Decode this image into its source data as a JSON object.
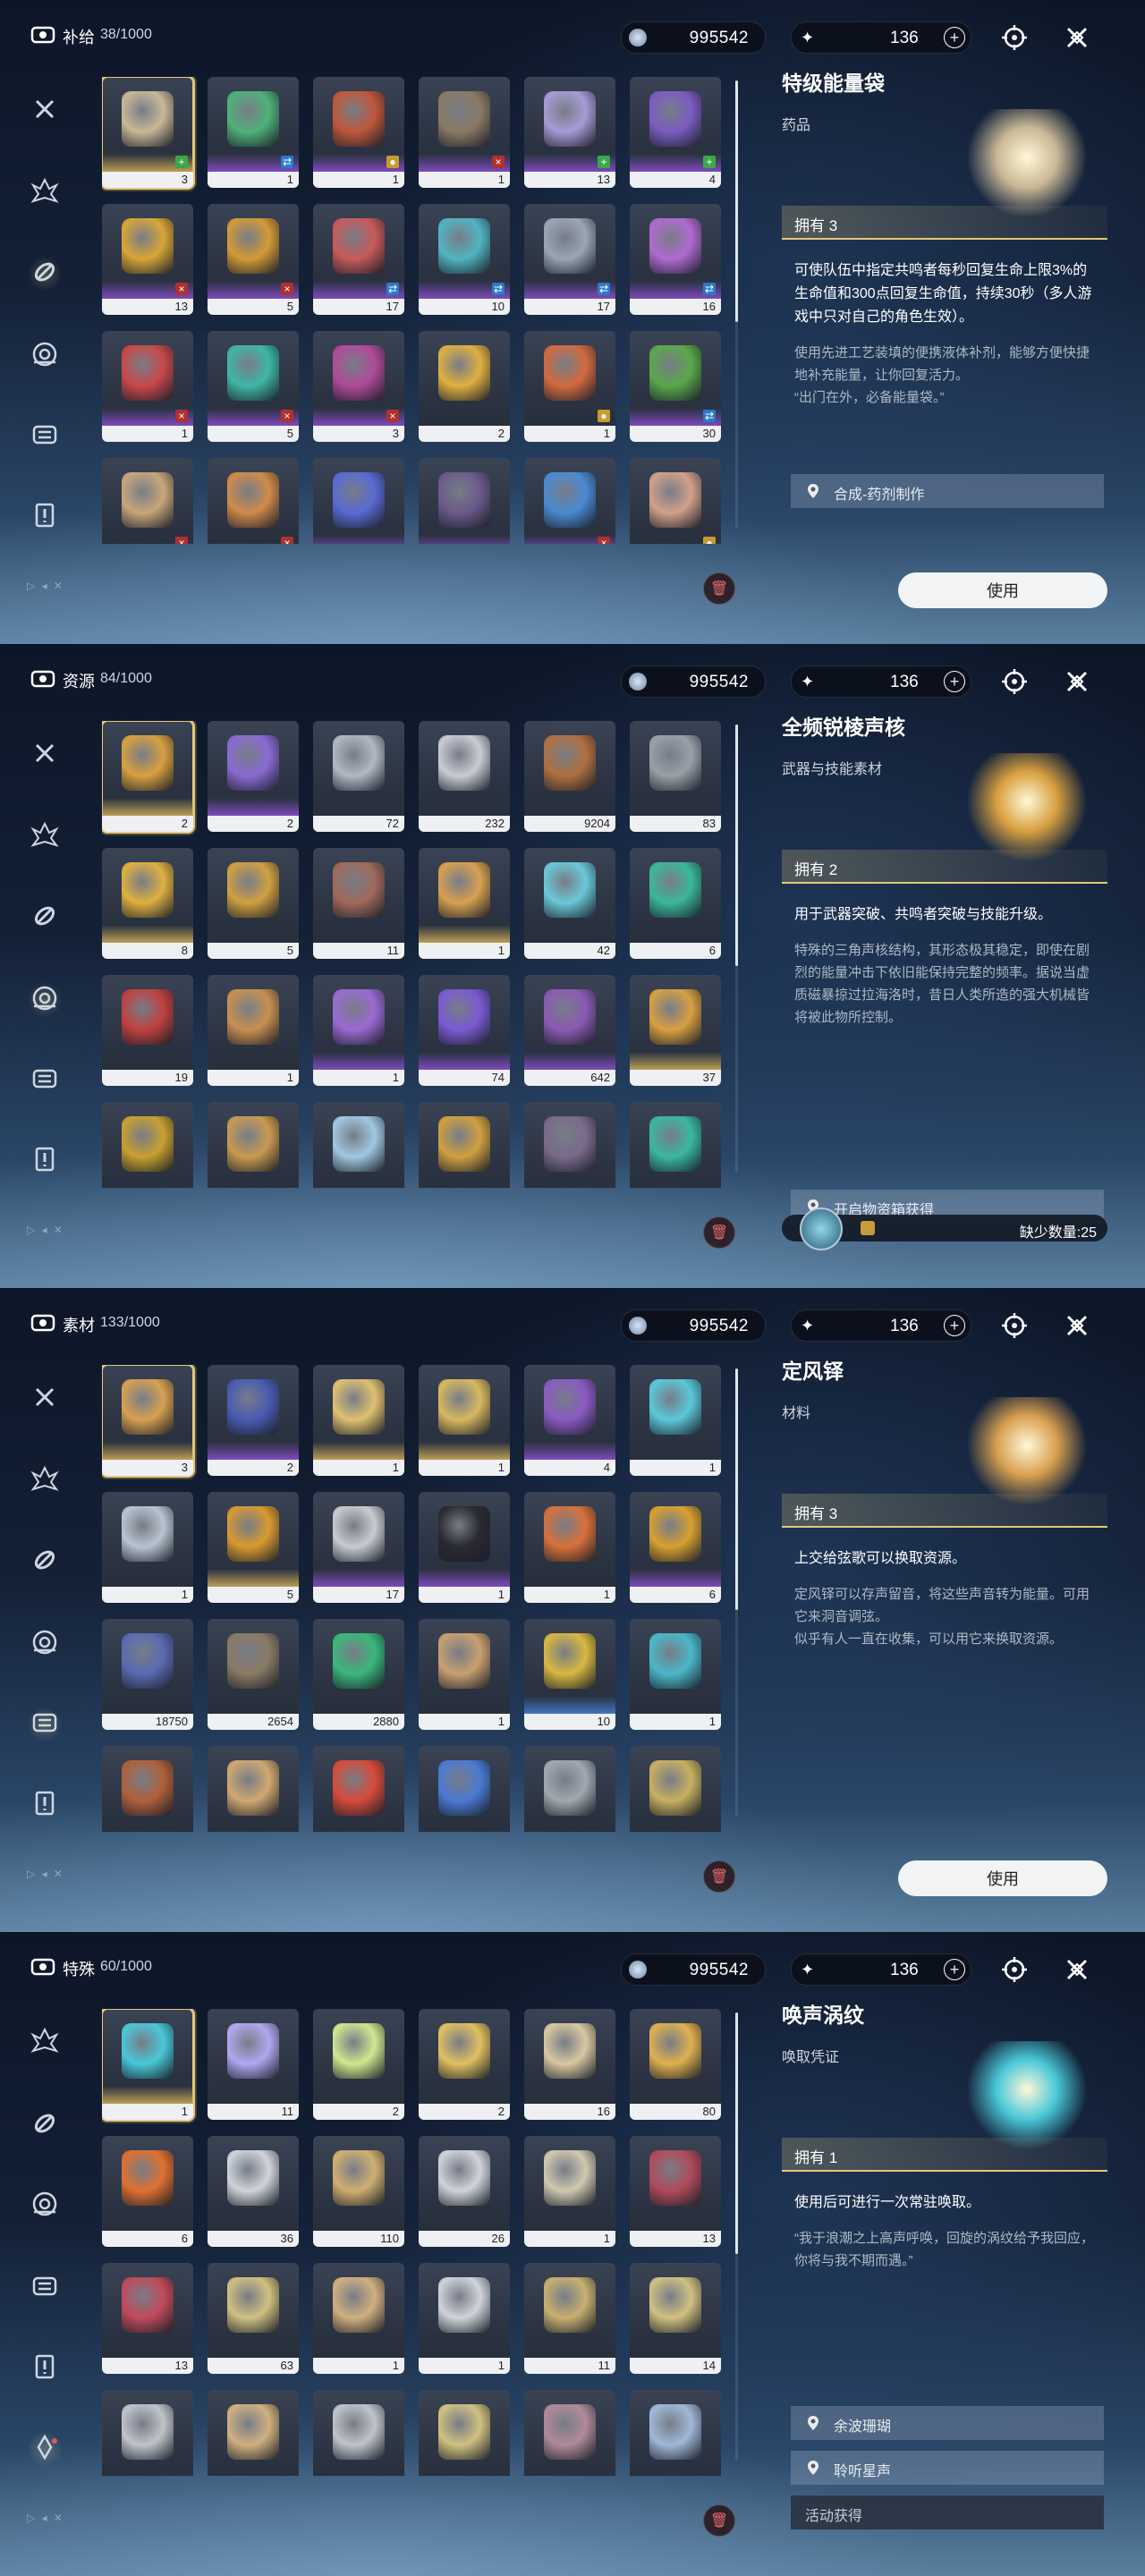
{
  "panels": [
    {
      "category": "补给",
      "count": "38/1000",
      "currency": "995542",
      "stamina": "136",
      "detail": {
        "name": "特级能量袋",
        "type": "药品",
        "owned": "拥有 3",
        "effect": "可使队伍中指定共鸣者每秒回复生命上限3%的生命值和300点回复生命值，持续30秒（多人游戏中只对自己的角色生效）。",
        "description": "使用先进工艺装填的便携液体补剂，能够方便快捷地补充能量，让你回复活力。\n“出门在外，必备能量袋。”",
        "sources": [
          "合成-药剂制作"
        ],
        "use_label": "使用"
      },
      "items": [
        {
          "count": "3",
          "color": "#c9b896",
          "bar": "gold",
          "tag": "plus"
        },
        {
          "count": "1",
          "color": "#4fb27a",
          "bar": "purple",
          "tag": "swap"
        },
        {
          "count": "1",
          "color": "#c0573a",
          "bar": "purple",
          "tag": "gold"
        },
        {
          "count": "1",
          "color": "#8a7a64",
          "bar": "purple",
          "tag": "x"
        },
        {
          "count": "13",
          "color": "#a89bd6",
          "bar": "purple",
          "tag": "plus"
        },
        {
          "count": "4",
          "color": "#7b5cc2",
          "bar": "purple",
          "tag": "plus"
        },
        {
          "count": "13",
          "color": "#d9a636",
          "bar": "purple",
          "tag": "x"
        },
        {
          "count": "5",
          "color": "#d49a36",
          "bar": "purple",
          "tag": "x"
        },
        {
          "count": "17",
          "color": "#c85a5a",
          "bar": "purple",
          "tag": "swap"
        },
        {
          "count": "10",
          "color": "#52b4c2",
          "bar": "purple",
          "tag": "swap"
        },
        {
          "count": "17",
          "color": "#9aa6b4",
          "bar": "purple",
          "tag": "swap"
        },
        {
          "count": "16",
          "color": "#b06ad0",
          "bar": "purple",
          "tag": "swap"
        },
        {
          "count": "1",
          "color": "#c84848",
          "bar": "purple",
          "tag": "x"
        },
        {
          "count": "5",
          "color": "#3fb6a6",
          "bar": "purple",
          "tag": "x"
        },
        {
          "count": "3",
          "color": "#b04a9a",
          "bar": "purple",
          "tag": "x"
        },
        {
          "count": "2",
          "color": "#e0b040",
          "bar": "none",
          "tag": "none"
        },
        {
          "count": "1",
          "color": "#d26a40",
          "bar": "none",
          "tag": "gold"
        },
        {
          "count": "30",
          "color": "#5aa84a",
          "bar": "purple",
          "tag": "swap"
        },
        {
          "count": "",
          "color": "#c8a67a",
          "bar": "none",
          "tag": "x"
        },
        {
          "count": "",
          "color": "#d08a4a",
          "bar": "none",
          "tag": "x"
        },
        {
          "count": "",
          "color": "#5a6ad2",
          "bar": "purple",
          "tag": "none"
        },
        {
          "count": "",
          "color": "#6a5a8a",
          "bar": "purple",
          "tag": "none"
        },
        {
          "count": "",
          "color": "#4a8ad2",
          "bar": "purple",
          "tag": "x"
        },
        {
          "count": "",
          "color": "#d2a08a",
          "bar": "none",
          "tag": "gold"
        }
      ]
    },
    {
      "category": "资源",
      "count": "84/1000",
      "currency": "995542",
      "stamina": "136",
      "detail": {
        "name": "全频锐棱声核",
        "type": "武器与技能素材",
        "owned": "拥有 2",
        "effect": "用于武器突破、共鸣者突破与技能升级。",
        "description": "特殊的三角声核结构，其形态极其稳定，即使在剧烈的能量冲击下依旧能保持完整的频率。据说当虚质磁暴掠过拉海洛时，昔日人类所造的强大机械皆将被此物所控制。",
        "sources": [
          "开启物资箱获得"
        ],
        "missing": "缺少数量:25"
      },
      "items": [
        {
          "count": "2",
          "color": "#d8a040",
          "bar": "gold",
          "tag": "none"
        },
        {
          "count": "2",
          "color": "#8a6ad2",
          "bar": "purple",
          "tag": "none"
        },
        {
          "count": "72",
          "color": "#b0b8c4",
          "bar": "none",
          "tag": "none"
        },
        {
          "count": "232",
          "color": "#c8ccd4",
          "bar": "none",
          "tag": "none"
        },
        {
          "count": "9204",
          "color": "#b07040",
          "bar": "none",
          "tag": "none"
        },
        {
          "count": "83",
          "color": "#9aa0a8",
          "bar": "none",
          "tag": "none"
        },
        {
          "count": "8",
          "color": "#e0b040",
          "bar": "gold",
          "tag": "none"
        },
        {
          "count": "5",
          "color": "#d0a040",
          "bar": "none",
          "tag": "none"
        },
        {
          "count": "11",
          "color": "#a06a5a",
          "bar": "none",
          "tag": "none"
        },
        {
          "count": "1",
          "color": "#d8a050",
          "bar": "gold",
          "tag": "none"
        },
        {
          "count": "42",
          "color": "#6ac8d8",
          "bar": "none",
          "tag": "none"
        },
        {
          "count": "6",
          "color": "#3ab89a",
          "bar": "none",
          "tag": "none"
        },
        {
          "count": "19",
          "color": "#c04040",
          "bar": "none",
          "tag": "none"
        },
        {
          "count": "1",
          "color": "#c89050",
          "bar": "none",
          "tag": "none"
        },
        {
          "count": "1",
          "color": "#9a6ad2",
          "bar": "purple",
          "tag": "none"
        },
        {
          "count": "74",
          "color": "#7a5ad2",
          "bar": "purple",
          "tag": "none"
        },
        {
          "count": "642",
          "color": "#8a5ab2",
          "bar": "purple",
          "tag": "none"
        },
        {
          "count": "37",
          "color": "#d8a040",
          "bar": "gold",
          "tag": "none"
        },
        {
          "count": "",
          "color": "#c8a030",
          "bar": "none",
          "tag": "none"
        },
        {
          "count": "",
          "color": "#c89a50",
          "bar": "none",
          "tag": "none"
        },
        {
          "count": "",
          "color": "#a0c8e0",
          "bar": "none",
          "tag": "none"
        },
        {
          "count": "",
          "color": "#d0a040",
          "bar": "none",
          "tag": "none"
        },
        {
          "count": "",
          "color": "#7a6a8a",
          "bar": "none",
          "tag": "none"
        },
        {
          "count": "",
          "color": "#3ab8a0",
          "bar": "none",
          "tag": "none"
        }
      ]
    },
    {
      "category": "素材",
      "count": "133/1000",
      "currency": "995542",
      "stamina": "136",
      "detail": {
        "name": "定风铎",
        "type": "材料",
        "owned": "拥有 3",
        "effect": "上交给弦歌可以换取资源。",
        "description": "定风铎可以存声留音，将这些声音转为能量。可用它来洞音调弦。\n似乎有人一直在收集，可以用它来换取资源。",
        "use_label": "使用"
      },
      "items": [
        {
          "count": "3",
          "color": "#d8a050",
          "bar": "gold",
          "tag": "none"
        },
        {
          "count": "2",
          "color": "#4a5ab2",
          "bar": "purple",
          "tag": "none"
        },
        {
          "count": "1",
          "color": "#e0c070",
          "bar": "gold",
          "tag": "none"
        },
        {
          "count": "1",
          "color": "#d8b860",
          "bar": "gold",
          "tag": "none"
        },
        {
          "count": "4",
          "color": "#8a5ac2",
          "bar": "purple",
          "tag": "none"
        },
        {
          "count": "1",
          "color": "#5ac8d8",
          "bar": "none",
          "tag": "none"
        },
        {
          "count": "1",
          "color": "#b8c4d0",
          "bar": "none",
          "tag": "none"
        },
        {
          "count": "5",
          "color": "#d89a30",
          "bar": "gold",
          "tag": "none"
        },
        {
          "count": "17",
          "color": "#c8ccd0",
          "bar": "purple",
          "tag": "none"
        },
        {
          "count": "1",
          "color": "#2a2a30",
          "bar": "purple",
          "tag": "none"
        },
        {
          "count": "1",
          "color": "#d8703a",
          "bar": "none",
          "tag": "none"
        },
        {
          "count": "6",
          "color": "#d8a030",
          "bar": "purple",
          "tag": "none"
        },
        {
          "count": "18750",
          "color": "#5a6ab2",
          "bar": "none",
          "tag": "none"
        },
        {
          "count": "2654",
          "color": "#8a7a64",
          "bar": "none",
          "tag": "none"
        },
        {
          "count": "2880",
          "color": "#3ab87a",
          "bar": "none",
          "tag": "none"
        },
        {
          "count": "1",
          "color": "#c8a070",
          "bar": "none",
          "tag": "none"
        },
        {
          "count": "10",
          "color": "#d8b840",
          "bar": "blue",
          "tag": "none"
        },
        {
          "count": "1",
          "color": "#4ab8c8",
          "bar": "none",
          "tag": "none"
        },
        {
          "count": "",
          "color": "#b0603a",
          "bar": "none",
          "tag": "none"
        },
        {
          "count": "",
          "color": "#d0a870",
          "bar": "none",
          "tag": "none"
        },
        {
          "count": "",
          "color": "#d84a3a",
          "bar": "none",
          "tag": "none"
        },
        {
          "count": "",
          "color": "#4a7ad2",
          "bar": "none",
          "tag": "none"
        },
        {
          "count": "",
          "color": "#a0a8b0",
          "bar": "none",
          "tag": "none"
        },
        {
          "count": "",
          "color": "#c8b060",
          "bar": "none",
          "tag": "none"
        }
      ]
    },
    {
      "category": "特殊",
      "count": "60/1000",
      "currency": "995542",
      "stamina": "136",
      "detail": {
        "name": "唤声涡纹",
        "type": "唤取凭证",
        "owned": "拥有 1",
        "effect": "使用后可进行一次常驻唤取。",
        "description": "“我于浪潮之上高声呼唤，回旋的涡纹给予我回应，你将与我不期而遇。”",
        "sources": [
          "余波珊瑚",
          "聆听星声"
        ],
        "source_extra": "活动获得"
      },
      "items": [
        {
          "count": "1",
          "color": "#4ac8d8",
          "bar": "gold",
          "tag": "none"
        },
        {
          "count": "11",
          "color": "#b0a8f0",
          "bar": "none",
          "tag": "none"
        },
        {
          "count": "2",
          "color": "#d0e890",
          "bar": "none",
          "tag": "none"
        },
        {
          "count": "2",
          "color": "#e0c060",
          "bar": "none",
          "tag": "none"
        },
        {
          "count": "16",
          "color": "#d8c8a0",
          "bar": "none",
          "tag": "none"
        },
        {
          "count": "80",
          "color": "#e0b050",
          "bar": "none",
          "tag": "none"
        },
        {
          "count": "6",
          "color": "#e07030",
          "bar": "none",
          "tag": "none"
        },
        {
          "count": "36",
          "color": "#d0d4da",
          "bar": "none",
          "tag": "none"
        },
        {
          "count": "110",
          "color": "#d0b070",
          "bar": "none",
          "tag": "none"
        },
        {
          "count": "26",
          "color": "#d0d4da",
          "bar": "none",
          "tag": "none"
        },
        {
          "count": "1",
          "color": "#d0c8b0",
          "bar": "none",
          "tag": "none"
        },
        {
          "count": "13",
          "color": "#b04a5a",
          "bar": "none",
          "tag": "none"
        },
        {
          "count": "13",
          "color": "#c04a5a",
          "bar": "none",
          "tag": "none"
        },
        {
          "count": "63",
          "color": "#d0c080",
          "bar": "none",
          "tag": "none"
        },
        {
          "count": "1",
          "color": "#d0b080",
          "bar": "none",
          "tag": "none"
        },
        {
          "count": "1",
          "color": "#d0d4da",
          "bar": "none",
          "tag": "none"
        },
        {
          "count": "11",
          "color": "#c8b070",
          "bar": "none",
          "tag": "none"
        },
        {
          "count": "14",
          "color": "#d0c080",
          "bar": "none",
          "tag": "none"
        },
        {
          "count": "",
          "color": "#c0c4ca",
          "bar": "none",
          "tag": "none"
        },
        {
          "count": "",
          "color": "#d0b080",
          "bar": "none",
          "tag": "none"
        },
        {
          "count": "",
          "color": "#c0c4ca",
          "bar": "none",
          "tag": "none"
        },
        {
          "count": "",
          "color": "#d0c080",
          "bar": "none",
          "tag": "none"
        },
        {
          "count": "",
          "color": "#b08a9a",
          "bar": "none",
          "tag": "none"
        },
        {
          "count": "",
          "color": "#a0b8d8",
          "bar": "none",
          "tag": "none"
        }
      ]
    }
  ]
}
